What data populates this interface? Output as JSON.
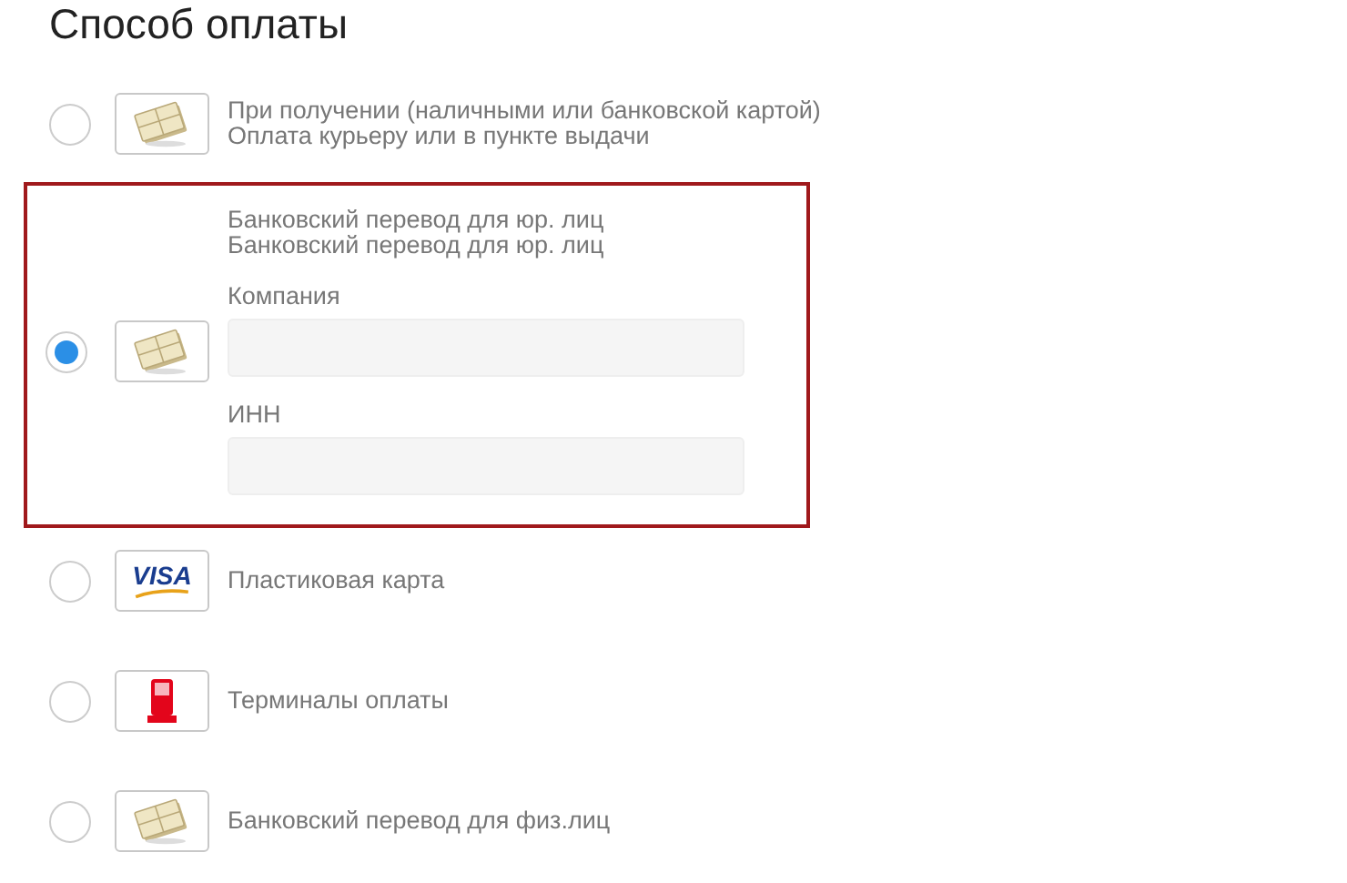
{
  "title": "Способ оплаты",
  "options": [
    {
      "kind": "cash",
      "lines": [
        "При получении (наличными или банковской картой)",
        "Оплата курьеру или в пункте выдачи"
      ],
      "selected": false
    },
    {
      "kind": "cash",
      "lines": [
        "Банковский перевод для юр. лиц",
        "Банковский перевод для юр. лиц"
      ],
      "selected": true,
      "fields": [
        {
          "label": "Компания"
        },
        {
          "label": "ИНН"
        }
      ]
    },
    {
      "kind": "card",
      "logo_text": "VISA",
      "lines": [
        "Пластиковая карта"
      ],
      "selected": false
    },
    {
      "kind": "terminal",
      "lines": [
        "Терминалы оплаты"
      ],
      "selected": false
    },
    {
      "kind": "cash",
      "lines": [
        "Банковский перевод для физ.лиц"
      ],
      "selected": false
    }
  ]
}
